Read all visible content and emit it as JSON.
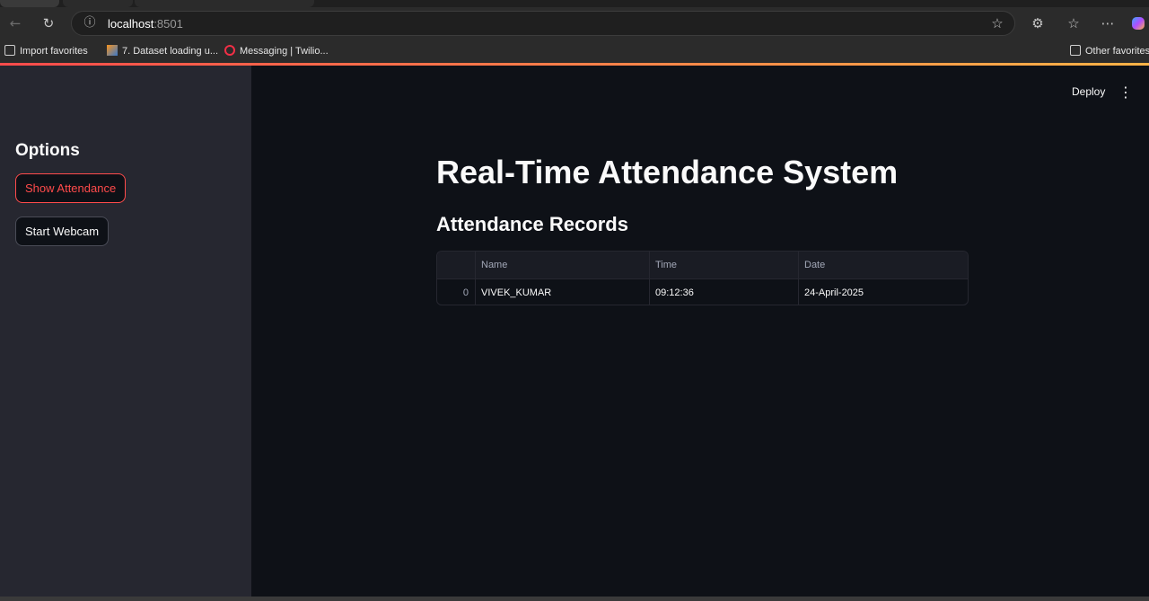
{
  "browser": {
    "url_host": "localhost",
    "url_port": ":8501",
    "bookmarks": {
      "import_favorites": "Import favorites",
      "dataset_loading": "7. Dataset loading u...",
      "twilio": "Messaging | Twilio...",
      "other_favorites": "Other favorites"
    },
    "icons": {
      "back": "arrow-left-icon",
      "refresh": "refresh-icon",
      "info": "info-icon",
      "star": "star-icon",
      "extensions": "extensions-icon",
      "favorites": "favorites-icon",
      "more": "more-icon",
      "copilot": "copilot-icon"
    }
  },
  "sidebar": {
    "title": "Options",
    "buttons": [
      {
        "label": "Show Attendance",
        "active": true
      },
      {
        "label": "Start Webcam",
        "active": false
      }
    ]
  },
  "header": {
    "deploy_label": "Deploy"
  },
  "main": {
    "title": "Real-Time Attendance System",
    "section_title": "Attendance Records",
    "table": {
      "columns": [
        "",
        "Name",
        "Time",
        "Date"
      ],
      "rows": [
        {
          "index": "0",
          "name": "VIVEK_KUMAR",
          "time": "09:12:36",
          "date": "24-April-2025"
        }
      ]
    }
  },
  "colors": {
    "accent": "#ff4b4b",
    "sidebar_bg": "#262730",
    "main_bg": "#0e1117"
  }
}
